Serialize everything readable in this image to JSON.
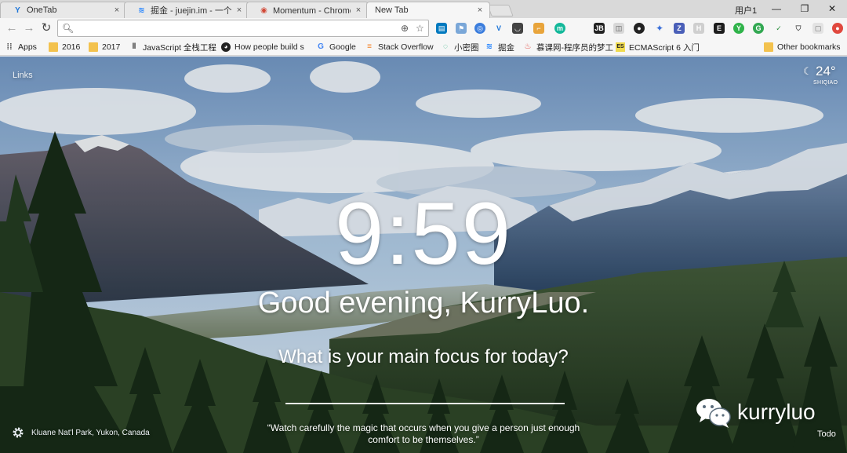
{
  "browser": {
    "tabs": [
      {
        "title": "OneTab",
        "favicon": "onetab-icon",
        "close": "×"
      },
      {
        "title": "掘金 - juejin.im - 一个帮助开发者成长的社区",
        "favicon": "juejin-icon",
        "close": "×"
      },
      {
        "title": "Momentum - Chrome 网上应用店",
        "favicon": "chrome-store-icon",
        "close": "×"
      },
      {
        "title": "New Tab",
        "favicon": "",
        "close": "×"
      }
    ],
    "user_label": "用户1",
    "window_controls": {
      "minimize": "—",
      "maximize": "❐",
      "close": "✕"
    }
  },
  "toolbar": {
    "back": "←",
    "forward": "→",
    "reload": "↻",
    "omnibox_value": "",
    "extension_icons": [
      "trello-icon",
      "flag-icon",
      "chrome-icon",
      "vue-icon",
      "pocket-icon",
      "tag-icon",
      "extension-icon",
      "m-icon",
      "hub-icon",
      "octocat-icon",
      "badge-icon",
      "z-icon",
      "h-icon",
      "e-icon",
      "y-icon",
      "g-icon",
      "v-icon",
      "shield-icon",
      "square-icon",
      "ball-icon"
    ]
  },
  "bookmarks": [
    {
      "label": "Apps",
      "icon": "apps-grid-icon"
    },
    {
      "label": "2016",
      "icon": "folder-icon"
    },
    {
      "label": "2017",
      "icon": "folder-icon"
    },
    {
      "label": "JavaScript 全栈工程",
      "icon": "runner-icon"
    },
    {
      "label": "How people build s",
      "icon": "github-icon"
    },
    {
      "label": "Google",
      "icon": "google-icon"
    },
    {
      "label": "Stack Overflow",
      "icon": "stackoverflow-icon"
    },
    {
      "label": "小密圈",
      "icon": "circle-icon"
    },
    {
      "label": "掘金",
      "icon": "juejin-icon"
    },
    {
      "label": "慕课网-程序员的梦工",
      "icon": "imooc-icon"
    },
    {
      "label": "ECMAScript 6 入门",
      "icon": "es-icon"
    },
    {
      "label": "Other bookmarks",
      "icon": "folder-icon"
    }
  ],
  "momentum": {
    "links_label": "Links",
    "weather": {
      "temperature": "24°",
      "location": "SHIQIAO",
      "icon": "moon-icon"
    },
    "time": "9:59",
    "greeting": "Good evening, KurryLuo.",
    "focus_question": "What is your main focus for today?",
    "focus_value": "",
    "quote": "“Watch carefully the magic that occurs when you give a person just enough comfort to be themselves.”",
    "photo_location": "Kluane Nat'l Park, Yukon, Canada",
    "todo_label": "Todo",
    "watermark": "kurryluo"
  },
  "colors": {
    "sky": "#8fb3d6",
    "mountain": "#3e4f63",
    "snow": "#f2f5f8",
    "forest": "#1e3a22"
  }
}
